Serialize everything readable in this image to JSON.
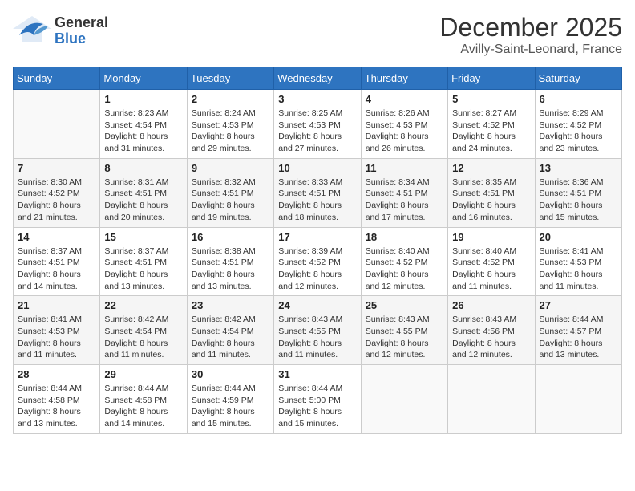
{
  "header": {
    "logo_general": "General",
    "logo_blue": "Blue",
    "month_title": "December 2025",
    "location": "Avilly-Saint-Leonard, France"
  },
  "days_of_week": [
    "Sunday",
    "Monday",
    "Tuesday",
    "Wednesday",
    "Thursday",
    "Friday",
    "Saturday"
  ],
  "weeks": [
    [
      {
        "day": "",
        "empty": true
      },
      {
        "day": "1",
        "sunrise": "8:23 AM",
        "sunset": "4:54 PM",
        "daylight": "8 hours and 31 minutes."
      },
      {
        "day": "2",
        "sunrise": "8:24 AM",
        "sunset": "4:53 PM",
        "daylight": "8 hours and 29 minutes."
      },
      {
        "day": "3",
        "sunrise": "8:25 AM",
        "sunset": "4:53 PM",
        "daylight": "8 hours and 27 minutes."
      },
      {
        "day": "4",
        "sunrise": "8:26 AM",
        "sunset": "4:53 PM",
        "daylight": "8 hours and 26 minutes."
      },
      {
        "day": "5",
        "sunrise": "8:27 AM",
        "sunset": "4:52 PM",
        "daylight": "8 hours and 24 minutes."
      },
      {
        "day": "6",
        "sunrise": "8:29 AM",
        "sunset": "4:52 PM",
        "daylight": "8 hours and 23 minutes."
      }
    ],
    [
      {
        "day": "7",
        "sunrise": "8:30 AM",
        "sunset": "4:52 PM",
        "daylight": "8 hours and 21 minutes."
      },
      {
        "day": "8",
        "sunrise": "8:31 AM",
        "sunset": "4:51 PM",
        "daylight": "8 hours and 20 minutes."
      },
      {
        "day": "9",
        "sunrise": "8:32 AM",
        "sunset": "4:51 PM",
        "daylight": "8 hours and 19 minutes."
      },
      {
        "day": "10",
        "sunrise": "8:33 AM",
        "sunset": "4:51 PM",
        "daylight": "8 hours and 18 minutes."
      },
      {
        "day": "11",
        "sunrise": "8:34 AM",
        "sunset": "4:51 PM",
        "daylight": "8 hours and 17 minutes."
      },
      {
        "day": "12",
        "sunrise": "8:35 AM",
        "sunset": "4:51 PM",
        "daylight": "8 hours and 16 minutes."
      },
      {
        "day": "13",
        "sunrise": "8:36 AM",
        "sunset": "4:51 PM",
        "daylight": "8 hours and 15 minutes."
      }
    ],
    [
      {
        "day": "14",
        "sunrise": "8:37 AM",
        "sunset": "4:51 PM",
        "daylight": "8 hours and 14 minutes."
      },
      {
        "day": "15",
        "sunrise": "8:37 AM",
        "sunset": "4:51 PM",
        "daylight": "8 hours and 13 minutes."
      },
      {
        "day": "16",
        "sunrise": "8:38 AM",
        "sunset": "4:51 PM",
        "daylight": "8 hours and 13 minutes."
      },
      {
        "day": "17",
        "sunrise": "8:39 AM",
        "sunset": "4:52 PM",
        "daylight": "8 hours and 12 minutes."
      },
      {
        "day": "18",
        "sunrise": "8:40 AM",
        "sunset": "4:52 PM",
        "daylight": "8 hours and 12 minutes."
      },
      {
        "day": "19",
        "sunrise": "8:40 AM",
        "sunset": "4:52 PM",
        "daylight": "8 hours and 11 minutes."
      },
      {
        "day": "20",
        "sunrise": "8:41 AM",
        "sunset": "4:53 PM",
        "daylight": "8 hours and 11 minutes."
      }
    ],
    [
      {
        "day": "21",
        "sunrise": "8:41 AM",
        "sunset": "4:53 PM",
        "daylight": "8 hours and 11 minutes."
      },
      {
        "day": "22",
        "sunrise": "8:42 AM",
        "sunset": "4:54 PM",
        "daylight": "8 hours and 11 minutes."
      },
      {
        "day": "23",
        "sunrise": "8:42 AM",
        "sunset": "4:54 PM",
        "daylight": "8 hours and 11 minutes."
      },
      {
        "day": "24",
        "sunrise": "8:43 AM",
        "sunset": "4:55 PM",
        "daylight": "8 hours and 11 minutes."
      },
      {
        "day": "25",
        "sunrise": "8:43 AM",
        "sunset": "4:55 PM",
        "daylight": "8 hours and 12 minutes."
      },
      {
        "day": "26",
        "sunrise": "8:43 AM",
        "sunset": "4:56 PM",
        "daylight": "8 hours and 12 minutes."
      },
      {
        "day": "27",
        "sunrise": "8:44 AM",
        "sunset": "4:57 PM",
        "daylight": "8 hours and 13 minutes."
      }
    ],
    [
      {
        "day": "28",
        "sunrise": "8:44 AM",
        "sunset": "4:58 PM",
        "daylight": "8 hours and 13 minutes."
      },
      {
        "day": "29",
        "sunrise": "8:44 AM",
        "sunset": "4:58 PM",
        "daylight": "8 hours and 14 minutes."
      },
      {
        "day": "30",
        "sunrise": "8:44 AM",
        "sunset": "4:59 PM",
        "daylight": "8 hours and 15 minutes."
      },
      {
        "day": "31",
        "sunrise": "8:44 AM",
        "sunset": "5:00 PM",
        "daylight": "8 hours and 15 minutes."
      },
      {
        "day": "",
        "empty": true
      },
      {
        "day": "",
        "empty": true
      },
      {
        "day": "",
        "empty": true
      }
    ]
  ]
}
